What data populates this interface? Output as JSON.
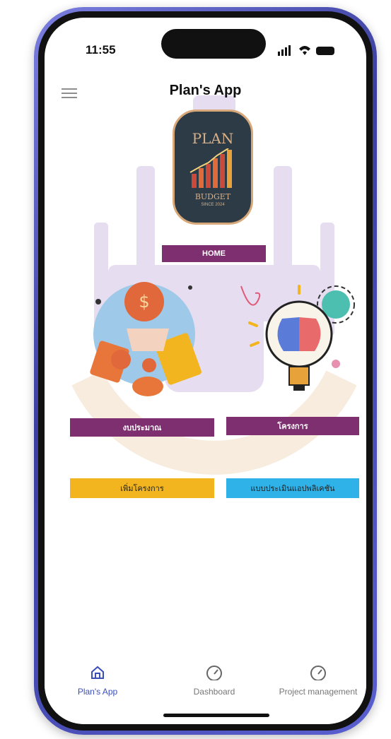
{
  "status_bar": {
    "time": "11:55"
  },
  "header": {
    "title": "Plan's App"
  },
  "logo": {
    "line1": "PLAN",
    "line2": "BUDGET",
    "line3": "SINCE 2024"
  },
  "buttons": {
    "home": "HOME",
    "budget": "งบประมาณ",
    "project": "โครงการ",
    "add_project": "เพิ่มโครงการ",
    "evaluation": "แบบประเมินแอปพลิเคชัน"
  },
  "nav": {
    "items": [
      {
        "label": "Plan's App",
        "icon": "home-icon",
        "active": true
      },
      {
        "label": "Dashboard",
        "icon": "gauge-icon",
        "active": false
      },
      {
        "label": "Project management",
        "icon": "gauge-icon",
        "active": false
      }
    ]
  },
  "colors": {
    "accent": "#7e2f6f",
    "nav_active": "#3b4fb8",
    "yellow": "#f2b51f",
    "blue": "#2fb2e8"
  }
}
